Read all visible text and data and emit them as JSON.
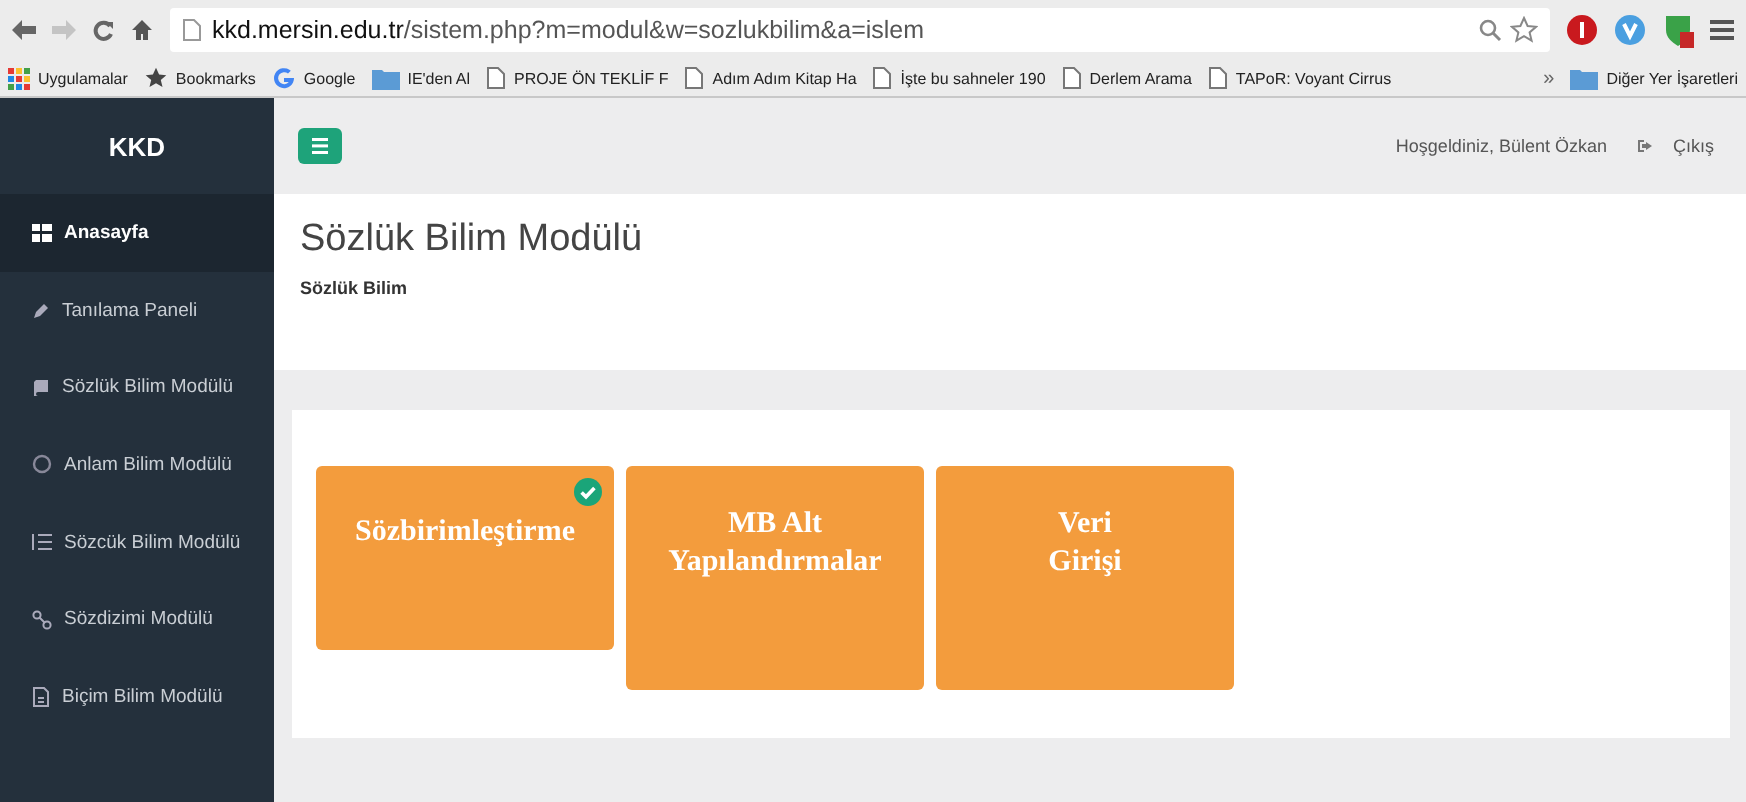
{
  "browser": {
    "address": {
      "host": "kkd.mersin.edu.tr",
      "path": "/sistem.php?m=modul&w=sozlukbilim&a=islem"
    },
    "bookmarks": [
      {
        "label": "Uygulamalar",
        "kind": "apps"
      },
      {
        "label": "Bookmarks",
        "kind": "star"
      },
      {
        "label": "Google",
        "kind": "google"
      },
      {
        "label": "IE'den Al",
        "kind": "folder"
      },
      {
        "label": "PROJE ÖN TEKLİF F",
        "kind": "page"
      },
      {
        "label": "Adım Adım Kitap Ha",
        "kind": "page"
      },
      {
        "label": "İşte bu sahneler 190",
        "kind": "page"
      },
      {
        "label": "Derlem Arama",
        "kind": "page"
      },
      {
        "label": "TAPoR: Voyant Cirrus",
        "kind": "page"
      }
    ],
    "overflow": "»",
    "other_bookmarks": "Diğer Yer İşaretleri"
  },
  "sidebar": {
    "brand": "KKD",
    "items": [
      {
        "label": "Anasayfa",
        "selected": true
      },
      {
        "label": "Tanılama Paneli",
        "selected": false
      },
      {
        "label": "Sözlük Bilim Modülü",
        "selected": false
      },
      {
        "label": "Anlam Bilim Modülü",
        "selected": false
      },
      {
        "label": "Sözcük Bilim Modülü",
        "selected": false
      },
      {
        "label": "Sözdizimi Modülü",
        "selected": false
      },
      {
        "label": "Biçim Bilim Modülü",
        "selected": false
      }
    ]
  },
  "topbar": {
    "greeting": "Hoşgeldiniz, Bülent Özkan",
    "logout": "Çıkış"
  },
  "header": {
    "title": "Sözlük Bilim Modülü",
    "breadcrumb": "Sözlük Bilim"
  },
  "tiles": [
    {
      "label": "Sözbirimleştirme",
      "checked": true
    },
    {
      "label": "MB Alt\nYapılandırmalar",
      "checked": false
    },
    {
      "label": "Veri\nGirişi",
      "checked": false
    }
  ]
}
